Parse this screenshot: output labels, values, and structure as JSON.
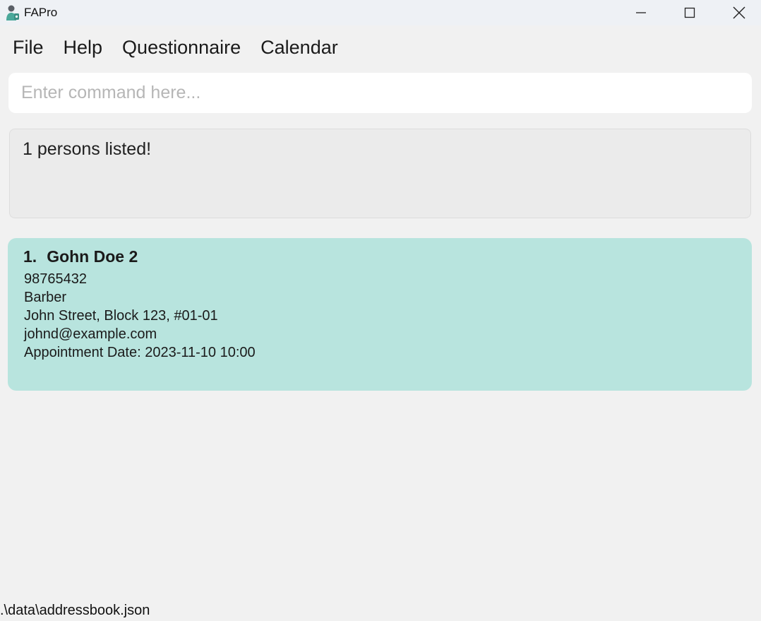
{
  "window": {
    "title": "FAPro",
    "app_icon": "person-app-icon",
    "controls": {
      "minimize_icon": "minimize-icon",
      "maximize_icon": "maximize-icon",
      "close_icon": "close-icon"
    }
  },
  "menu": {
    "items": [
      "File",
      "Help",
      "Questionnaire",
      "Calendar"
    ]
  },
  "command": {
    "value": "",
    "placeholder": "Enter command here..."
  },
  "result": {
    "message": "1 persons listed!"
  },
  "persons": [
    {
      "index": "1.",
      "name": "Gohn Doe 2",
      "phone": "98765432",
      "occupation": "Barber",
      "address": "John Street, Block 123, #01-01",
      "email": "johnd@example.com",
      "appointment": "Appointment Date: 2023-11-10 10:00"
    }
  ],
  "status_bar": {
    "path": ".\\data\\addressbook.json"
  },
  "colors": {
    "card_background": "#b8e4de",
    "window_background": "#f1f1f1"
  }
}
